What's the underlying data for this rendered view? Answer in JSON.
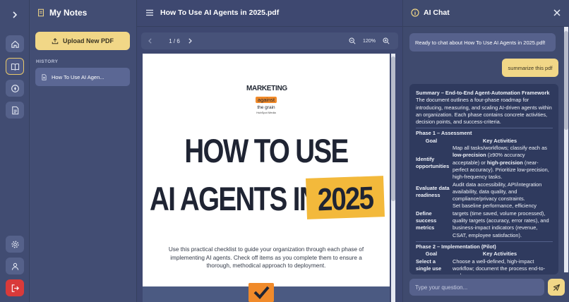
{
  "rail": {
    "items": [
      "expand",
      "home",
      "notebook",
      "compass",
      "document"
    ],
    "bottom": [
      "settings",
      "profile",
      "logout"
    ]
  },
  "notes": {
    "title": "My Notes",
    "upload_label": "Upload New PDF",
    "history_label": "HISTORY",
    "history_items": [
      {
        "label": "How To Use AI Agen..."
      }
    ]
  },
  "pdf": {
    "title": "How To Use AI Agents in 2025.pdf",
    "page_indicator": "1 / 6",
    "zoom": "120%",
    "doc": {
      "logo_top": "MARKETING",
      "logo_mid": "against",
      "logo_bot": "the grain",
      "logo_sub": "HubSpot Media",
      "headline_line1": "HOW TO USE",
      "headline_line2": "AI AGENTS IN",
      "headline_year": "2025",
      "intro": "Use this practical checklist to guide your organization through each phase of implementing AI agents. Check off items as you complete them to ensure a thorough, methodical approach to deployment."
    }
  },
  "chat": {
    "title": "AI Chat",
    "greeting": "Ready to chat about How To Use AI Agents in 2025.pdf!",
    "user_message": "summarize this pdf",
    "summary": {
      "title": "Summary – End-to-End Agent-Automation Framework",
      "intro": "The document outlines a four-phase roadmap for introducing, measuring, and scaling AI-driven agents within an organization. Each phase contains concrete activities, decision points, and success-criteria.",
      "phase1": {
        "title": "Phase 1 – Assessment",
        "col_goal": "Goal",
        "col_activities": "Key Activities",
        "rows": [
          {
            "goal": "Identify opportunities",
            "activity_a": "Map all tasks/workflows; classify each as ",
            "activity_b": "low-precision",
            "activity_c": " (≥90% accuracy acceptable) or ",
            "activity_d": "high-precision",
            "activity_e": " (near-perfect accuracy). Prioritize low-precision, high-frequency tasks."
          },
          {
            "goal": "Evaluate data readiness",
            "activity": "Audit data accessibility, API/integration availability, data quality, and compliance/privacy constraints."
          },
          {
            "goal": "Define success metrics",
            "activity": "Set baseline performance, efficiency targets (time saved, volume processed), quality targets (accuracy, error rates), and business-impact indicators (revenue, CSAT, employee satisfaction)."
          }
        ]
      },
      "phase2": {
        "title": "Phase 2 – Implementation (Pilot)",
        "col_goal": "Goal",
        "col_activities": "Key Activities",
        "rows": [
          {
            "goal": "Select a single use case",
            "activity": "Choose a well-defined, high-impact workflow; document the process end-to-end."
          }
        ]
      }
    },
    "input_placeholder": "Type your question..."
  }
}
